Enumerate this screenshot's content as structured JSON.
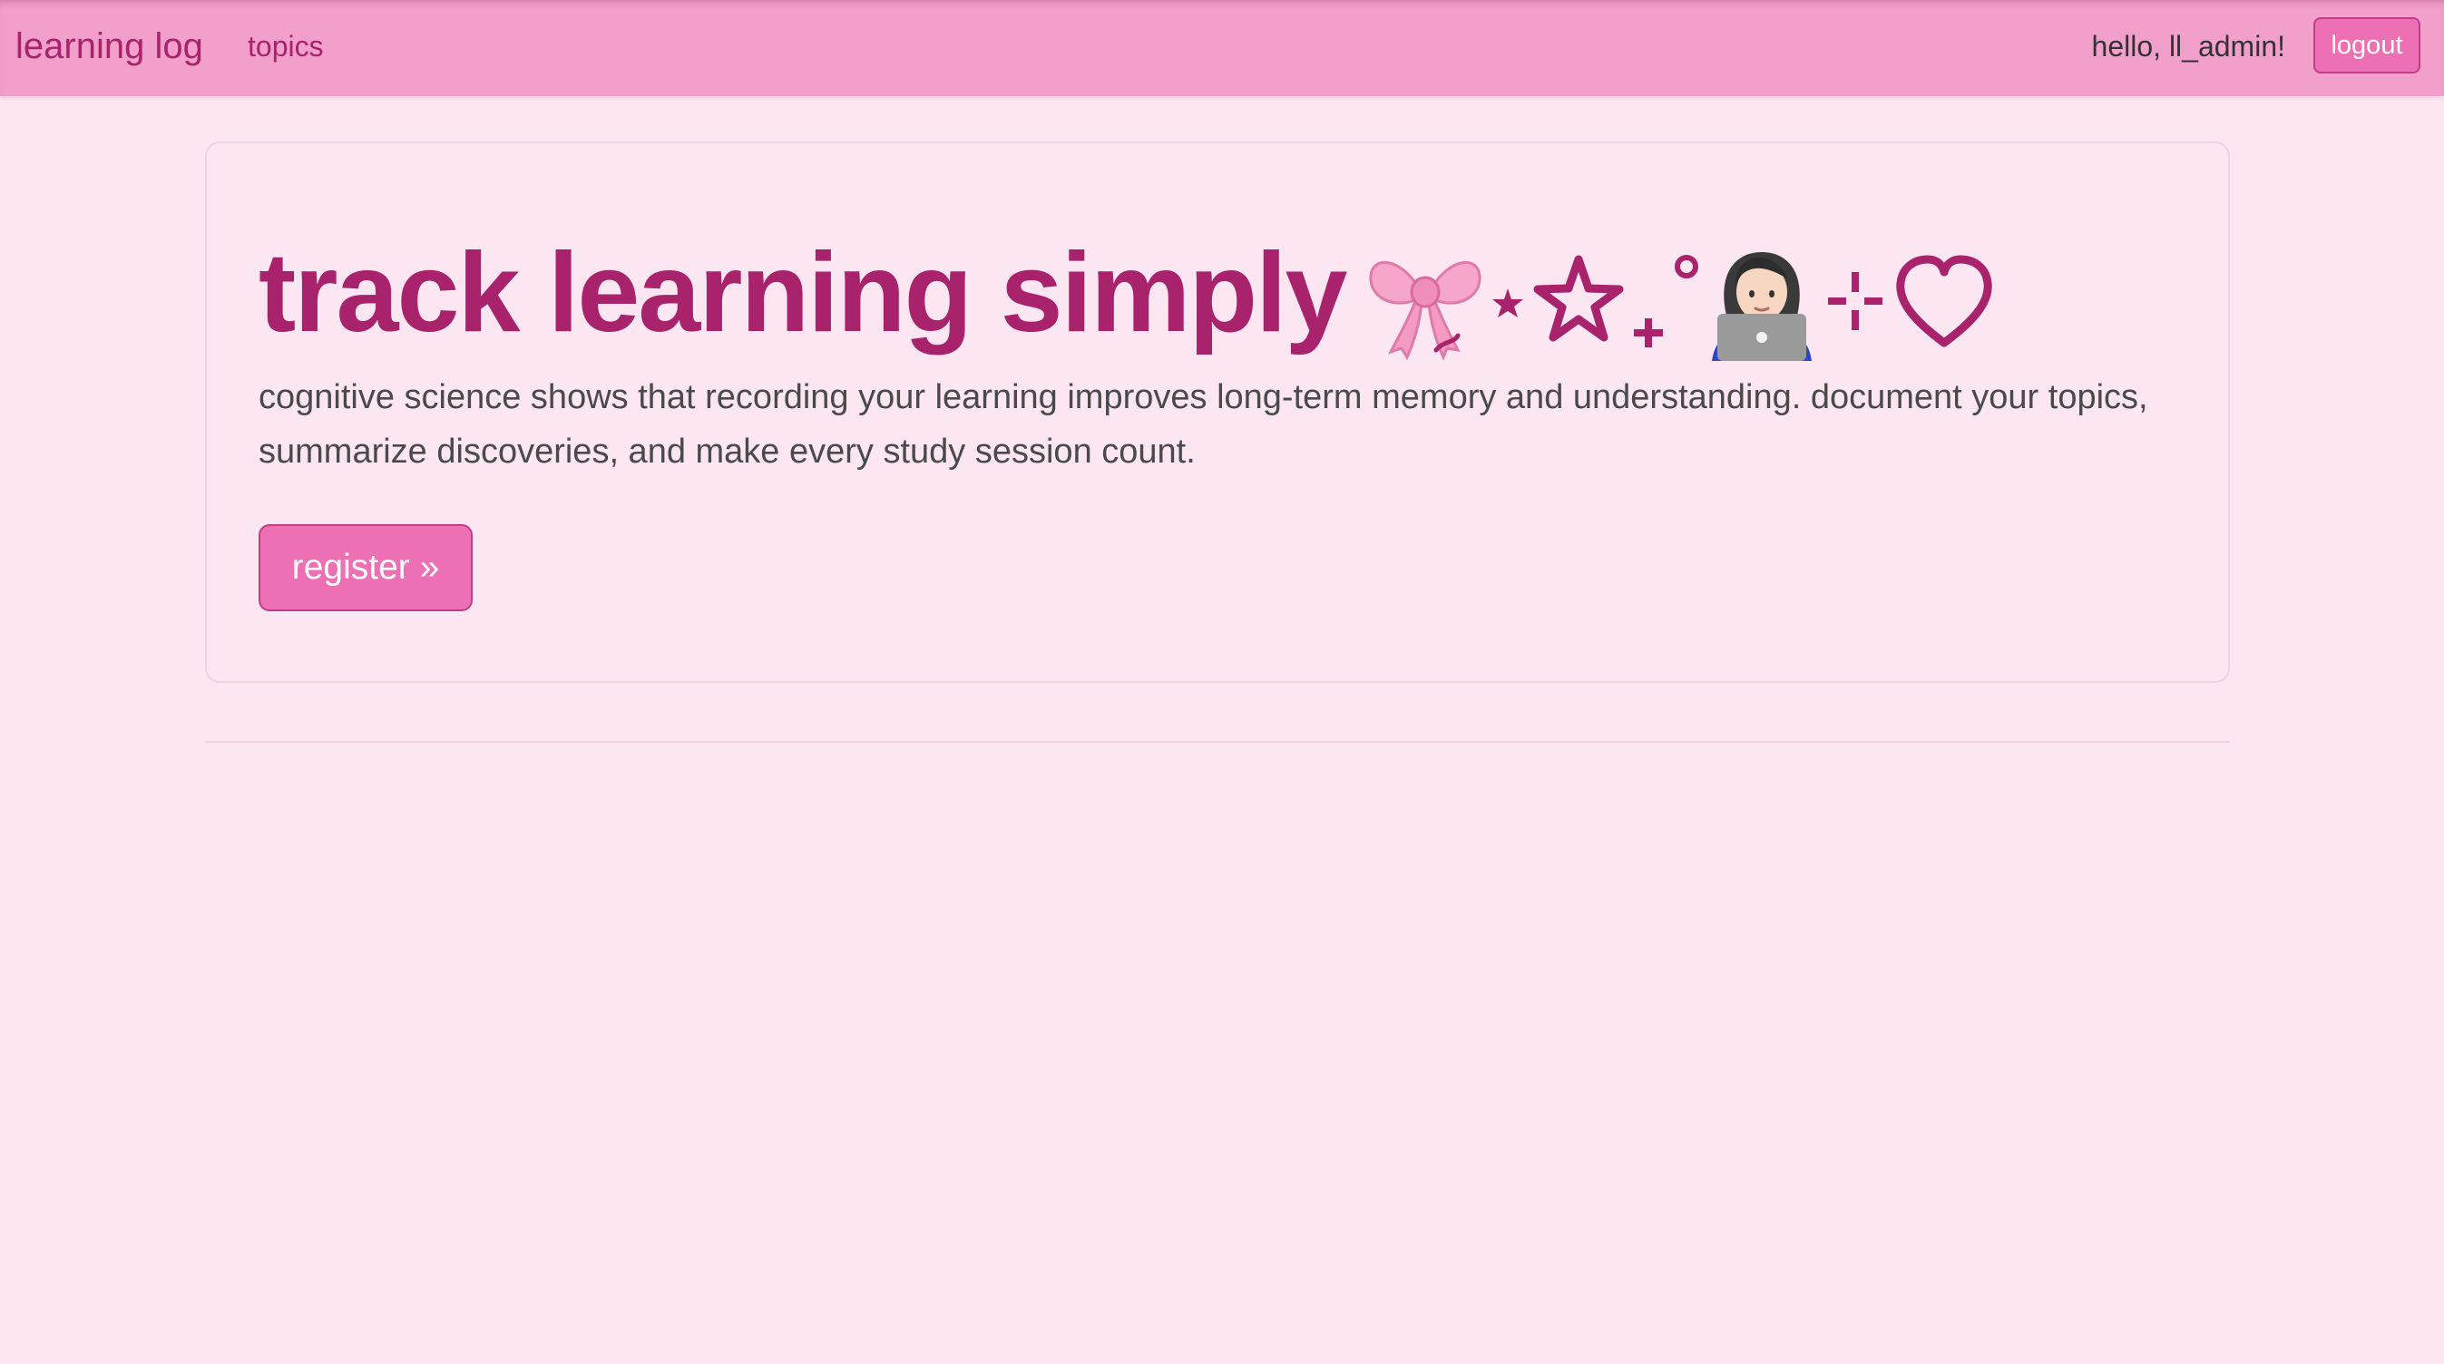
{
  "navbar": {
    "brand": "learning log",
    "topics_link": "topics",
    "greeting": "hello, ll_admin!",
    "logout_label": "logout"
  },
  "hero": {
    "headline": "track learning simply",
    "decoration_icons": [
      "bow-icon",
      "small-star-icon",
      "star-outline-icon",
      "plus-sparkle-icon",
      "ring-sparkle-icon",
      "woman-at-laptop-icon",
      "sparkle-icon",
      "heart-outline-icon"
    ],
    "lead": "cognitive science shows that recording your learning improves long-term memory and understanding. document your topics, summarize discoveries, and make every study session count.",
    "register_label": "register »"
  },
  "colors": {
    "accent": "#a8226c",
    "navbar_bg": "#f2a0cb",
    "page_bg": "#fbe6f1",
    "button_bg": "#ee70b4"
  }
}
